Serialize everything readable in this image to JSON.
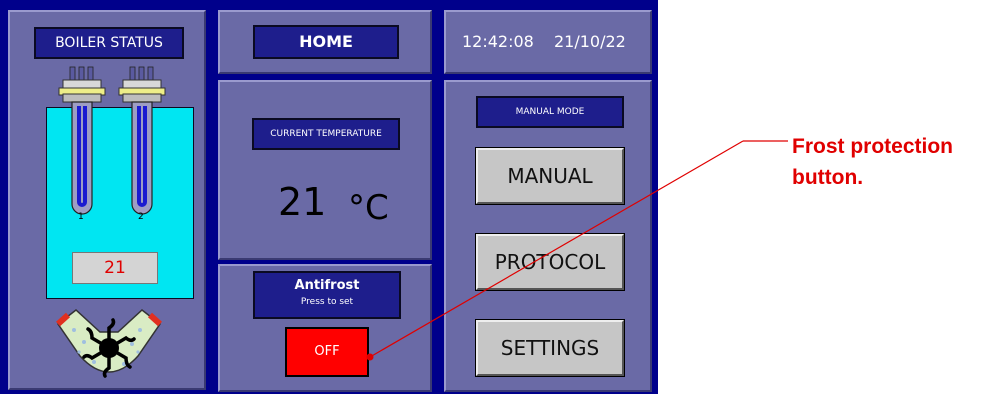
{
  "boiler": {
    "status_label": "BOILER STATUS",
    "heater_labels": [
      "1",
      "2"
    ],
    "temperature_value": "21"
  },
  "header": {
    "home_label": "HOME",
    "time": "12:42:08",
    "date": "21/10/22"
  },
  "temperature_panel": {
    "title": "CURRENT TEMPERATURE",
    "value": "21",
    "unit": "°C"
  },
  "antifrost": {
    "title": "Antifrost",
    "subtitle": "Press to set",
    "state_label": "OFF"
  },
  "menu": {
    "mode_label": "MANUAL MODE",
    "manual_label": "MANUAL",
    "protocol_label": "PROTOCOL",
    "settings_label": "SETTINGS"
  },
  "annotation": {
    "line1": "Frost protection",
    "line2": "button."
  },
  "colors": {
    "panel": "#6a6aa6",
    "frame": "#00008b",
    "button_navy": "#1e1e8c",
    "button_grey": "#c6c6c6",
    "tank_water": "#00e6f2",
    "alert_red": "#ff0000",
    "annotation_red": "#e00000"
  },
  "icons": [
    "heating-element-icon",
    "circulation-pump-icon"
  ]
}
